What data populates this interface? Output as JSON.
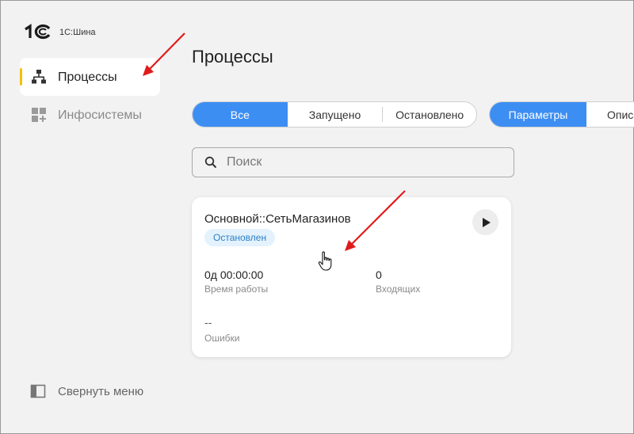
{
  "app": {
    "logo_text": "1С:Шина"
  },
  "sidebar": {
    "items": [
      {
        "label": "Процессы",
        "icon": "process-tree-icon",
        "active": true
      },
      {
        "label": "Инфосистемы",
        "icon": "apps-grid-icon",
        "active": false
      }
    ],
    "collapse_label": "Свернуть меню"
  },
  "main": {
    "title": "Процессы",
    "filter_tabs": [
      {
        "label": "Все",
        "active": true
      },
      {
        "label": "Запущено",
        "active": false
      },
      {
        "label": "Остановлено",
        "active": false
      }
    ],
    "view_tabs": [
      {
        "label": "Параметры",
        "active": true
      },
      {
        "label": "Описа",
        "active": false
      }
    ],
    "search": {
      "placeholder": "Поиск",
      "value": ""
    },
    "cards": [
      {
        "title": "Основной::СетьМагазинов",
        "status": "Остановлен",
        "uptime_value": "0д 00:00:00",
        "uptime_label": "Время работы",
        "incoming_value": "0",
        "incoming_label": "Входящих",
        "errors_value": "--",
        "errors_label": "Ошибки"
      }
    ]
  },
  "colors": {
    "accent": "#3d8ef3",
    "active_marker": "#f2c200",
    "annotation_arrow": "#e01b1b",
    "badge_bg": "#e3f2fd",
    "badge_text": "#2b7fc4"
  }
}
